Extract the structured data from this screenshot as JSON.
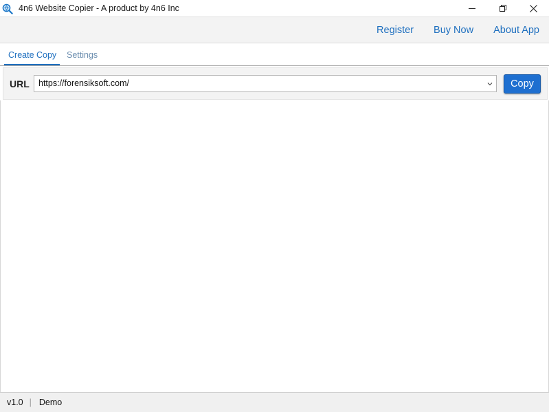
{
  "window": {
    "title": "4n6 Website Copier - A product by 4n6 Inc",
    "app_icon": "magnifier-globe-icon",
    "controls": [
      "minimize-icon",
      "restore-icon",
      "close-icon"
    ]
  },
  "header": {
    "links": [
      {
        "label": "Register"
      },
      {
        "label": "Buy Now"
      },
      {
        "label": "About App"
      }
    ]
  },
  "tabs": [
    {
      "label": "Create Copy",
      "active": true
    },
    {
      "label": "Settings",
      "active": false
    }
  ],
  "url_bar": {
    "label": "URL",
    "value": "https://forensiksoft.com/",
    "dropdown_icon": "chevron-down-icon",
    "copy_label": "Copy"
  },
  "status": {
    "version": "v1.0",
    "separator": "|",
    "mode": "Demo"
  },
  "colors": {
    "accent": "#1e6fbf",
    "button": "#1e6fd0",
    "toolbar_bg": "#f3f3f3"
  }
}
